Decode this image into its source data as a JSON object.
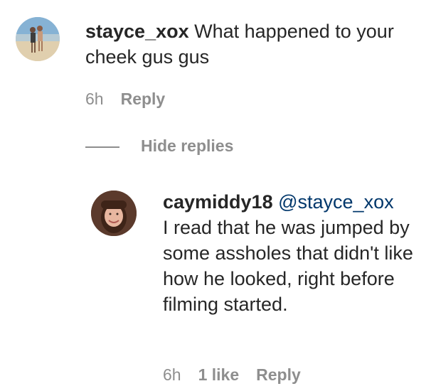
{
  "comment": {
    "username": "stayce_xox",
    "text": " What happened to your cheek gus gus",
    "time": "6h",
    "reply_label": "Reply"
  },
  "replies_toggle": {
    "label": "Hide replies"
  },
  "reply": {
    "username": "caymiddy18",
    "mention": "@stayce_xox",
    "text": "I read that he was jumped by some assholes that didn't like how he looked, right before filming started.",
    "time": "6h",
    "likes": "1 like",
    "reply_label": "Reply"
  }
}
